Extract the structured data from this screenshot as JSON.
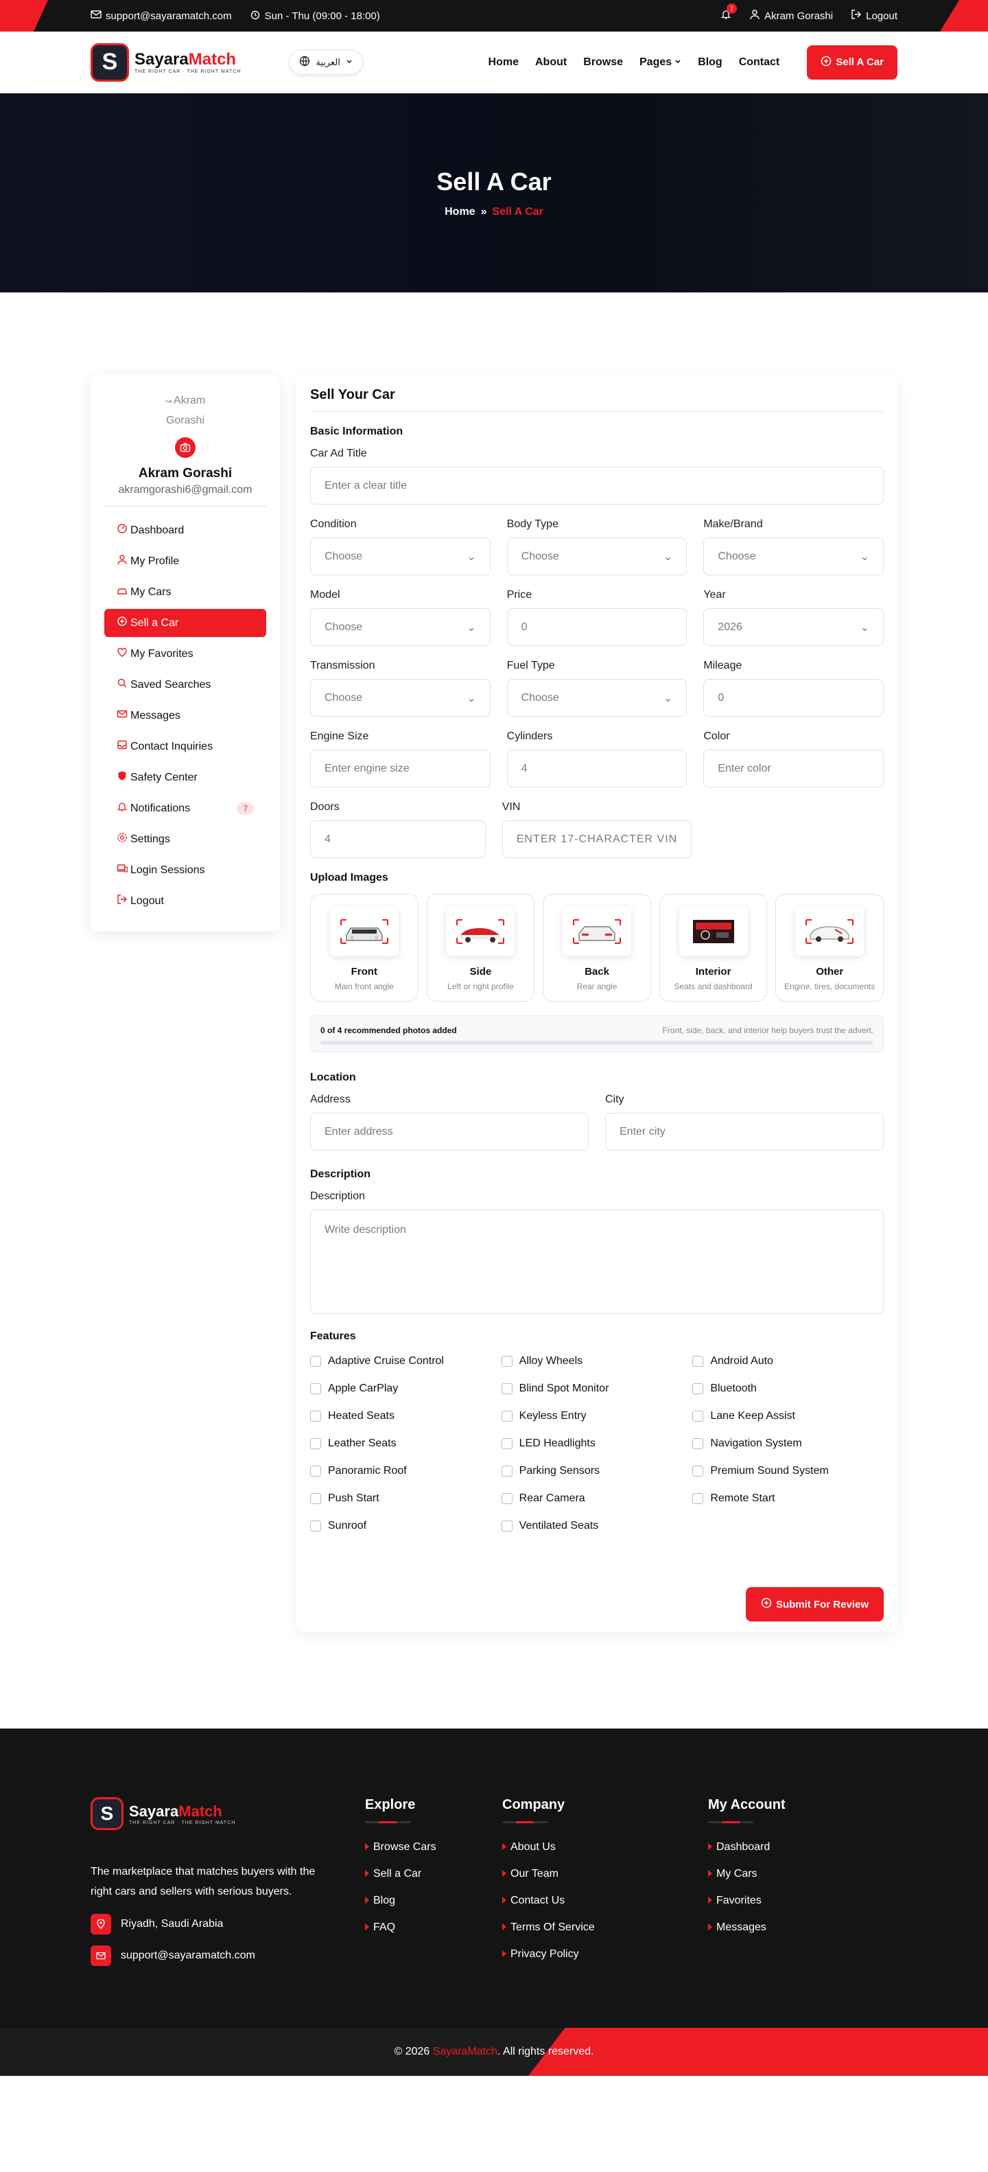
{
  "topbar": {
    "email": "support@sayaramatch.com",
    "hours": "Sun - Thu (09:00 - 18:00)",
    "notif_count": "7",
    "user": "Akram Gorashi",
    "logout": "Logout"
  },
  "nav": {
    "brand_a": "Sayara",
    "brand_b": "Match",
    "tagline": "THE RIGHT CAR · THE RIGHT MATCH",
    "lang": "العربية",
    "items": [
      "Home",
      "About",
      "Browse",
      "Pages",
      "Blog",
      "Contact"
    ],
    "cta": "Sell A Car"
  },
  "hero": {
    "title": "Sell A Car",
    "crumb_home": "Home",
    "crumb_sep": "»",
    "crumb_current": "Sell A Car"
  },
  "sidebar": {
    "avatar_alt": "Akram Gorashi",
    "name": "Akram Gorashi",
    "email": "akramgorashi6@gmail.com",
    "items": [
      {
        "label": "Dashboard"
      },
      {
        "label": "My Profile"
      },
      {
        "label": "My Cars"
      },
      {
        "label": "Sell a Car"
      },
      {
        "label": "My Favorites"
      },
      {
        "label": "Saved Searches"
      },
      {
        "label": "Messages"
      },
      {
        "label": "Contact Inquiries"
      },
      {
        "label": "Safety Center"
      },
      {
        "label": "Notifications",
        "badge": "7"
      },
      {
        "label": "Settings"
      },
      {
        "label": "Login Sessions"
      },
      {
        "label": "Logout"
      }
    ]
  },
  "form": {
    "title": "Sell Your Car",
    "basic": "Basic Information",
    "ad_title_label": "Car Ad Title",
    "ad_title_ph": "Enter a clear title",
    "condition_label": "Condition",
    "condition_val": "Choose",
    "body_label": "Body Type",
    "body_val": "Choose",
    "make_label": "Make/Brand",
    "make_val": "Choose",
    "model_label": "Model",
    "model_val": "Choose",
    "price_label": "Price",
    "price_ph": "0",
    "year_label": "Year",
    "year_val": "2026",
    "trans_label": "Transmission",
    "trans_val": "Choose",
    "fuel_label": "Fuel Type",
    "fuel_val": "Choose",
    "mileage_label": "Mileage",
    "mileage_ph": "0",
    "engine_label": "Engine Size",
    "engine_ph": "Enter engine size",
    "cyl_label": "Cylinders",
    "cyl_ph": "4",
    "color_label": "Color",
    "color_ph": "Enter color",
    "doors_label": "Doors",
    "doors_ph": "4",
    "vin_label": "VIN",
    "vin_ph": "ENTER 17-CHARACTER VIN",
    "upload": "Upload Images",
    "images": [
      {
        "title": "Front",
        "sub": "Main front angle"
      },
      {
        "title": "Side",
        "sub": "Left or right profile"
      },
      {
        "title": "Back",
        "sub": "Rear angle"
      },
      {
        "title": "Interior",
        "sub": "Seats and dashboard"
      },
      {
        "title": "Other",
        "sub": "Engine, tires, documents"
      }
    ],
    "progress_text": "0 of 4 recommended photos added",
    "progress_hint": "Front, side, back, and interior help buyers trust the advert.",
    "progress_value": 0,
    "location": "Location",
    "address_label": "Address",
    "address_ph": "Enter address",
    "city_label": "City",
    "city_ph": "Enter city",
    "desc_sec": "Description",
    "desc_label": "Description",
    "desc_ph": "Write description",
    "features_sec": "Features",
    "features": [
      "Adaptive Cruise Control",
      "Alloy Wheels",
      "Android Auto",
      "Apple CarPlay",
      "Blind Spot Monitor",
      "Bluetooth",
      "Heated Seats",
      "Keyless Entry",
      "Lane Keep Assist",
      "Leather Seats",
      "LED Headlights",
      "Navigation System",
      "Panoramic Roof",
      "Parking Sensors",
      "Premium Sound System",
      "Push Start",
      "Rear Camera",
      "Remote Start",
      "Sunroof",
      "Ventilated Seats"
    ],
    "submit": "Submit For Review"
  },
  "footer": {
    "desc": "The marketplace that matches buyers with the right cars and sellers with serious buyers.",
    "location": "Riyadh, Saudi Arabia",
    "email": "support@sayaramatch.com",
    "explore_title": "Explore",
    "explore": [
      "Browse Cars",
      "Sell a Car",
      "Blog",
      "FAQ"
    ],
    "company_title": "Company",
    "company": [
      "About Us",
      "Our Team",
      "Contact Us",
      "Terms Of Service",
      "Privacy Policy"
    ],
    "account_title": "My Account",
    "account": [
      "Dashboard",
      "My Cars",
      "Favorites",
      "Messages"
    ],
    "copyright_a": "© 2026",
    "copyright_brand": "SayaraMatch",
    "copyright_b": ". All rights reserved."
  },
  "colors": {
    "accent": "#ee1c25",
    "dark": "#141414"
  }
}
